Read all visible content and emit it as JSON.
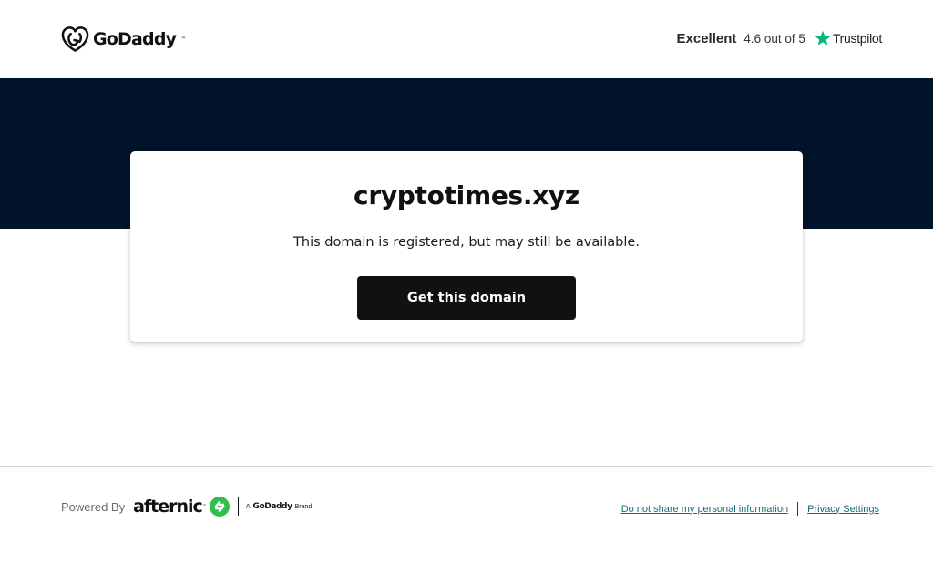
{
  "header": {
    "logo_text": "GoDaddy",
    "rating": {
      "word": "Excellent",
      "score_text": "4.6 out of 5",
      "provider": "Trustpilot",
      "star_color": "#00b67a"
    }
  },
  "hero": {
    "background_color": "#00132b",
    "domain": "cryptotimes.xyz",
    "description": "This domain is registered, but may still be available.",
    "cta_label": "Get this domain"
  },
  "footer": {
    "powered_label": "Powered By",
    "brand_name": "afternic",
    "brand_tagline_prefix": "A",
    "brand_tagline_company": "GoDaddy",
    "brand_tagline_suffix": "Brand",
    "links": [
      {
        "label": "Do not share my personal information"
      },
      {
        "label": "Privacy Settings"
      }
    ],
    "link_color": "#1b6a73",
    "afternic_color": "#2fbf4a"
  }
}
